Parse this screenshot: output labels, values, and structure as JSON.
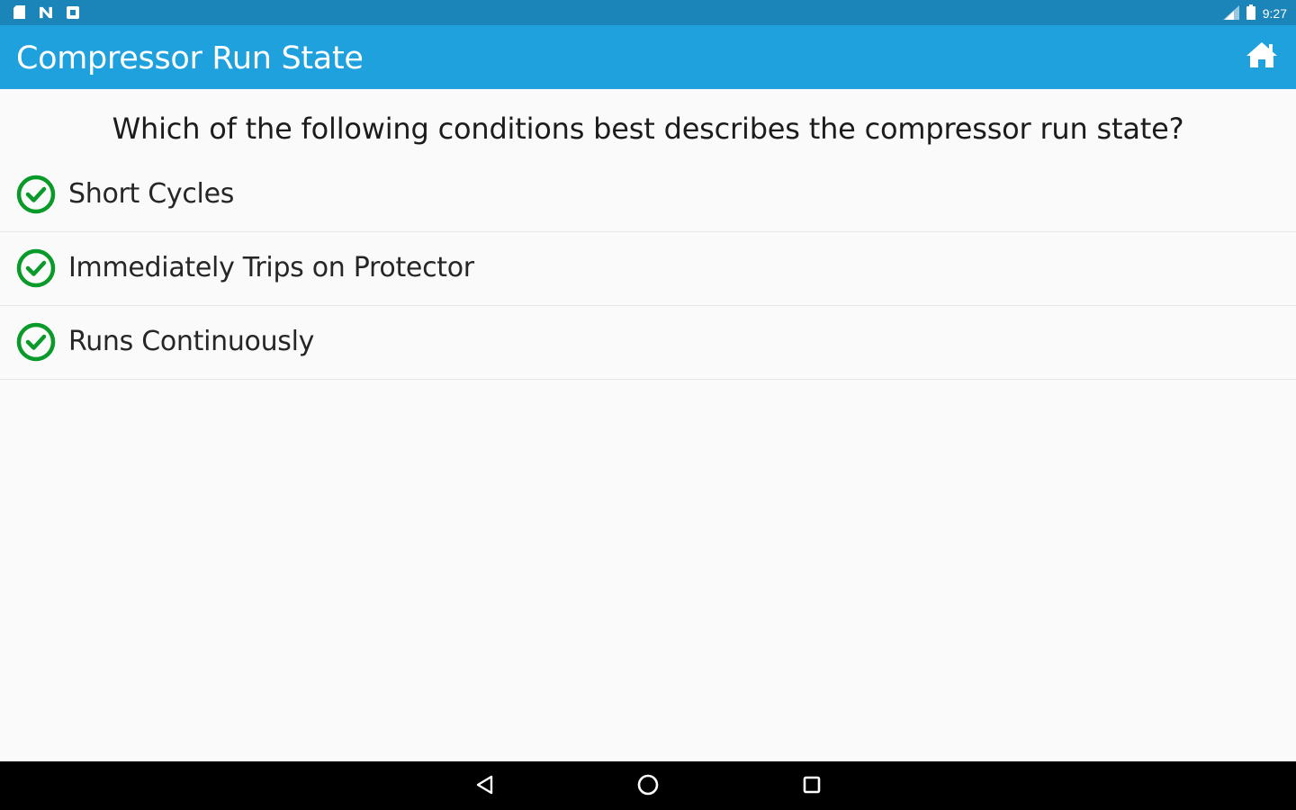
{
  "status_bar": {
    "time": "9:27",
    "left_icons": [
      "sd-card-icon",
      "n-icon",
      "notification-square-icon"
    ],
    "right_icons": [
      "signal-icon",
      "battery-icon"
    ]
  },
  "app_bar": {
    "title": "Compressor Run State",
    "home_icon": "home-icon"
  },
  "question": {
    "text": "Which of the following conditions best describes the compressor run state?"
  },
  "answers": [
    {
      "label": "Short Cycles",
      "icon": "check-circle-icon"
    },
    {
      "label": "Immediately Trips on Protector",
      "icon": "check-circle-icon"
    },
    {
      "label": "Runs Continuously",
      "icon": "check-circle-icon"
    }
  ],
  "nav_bar": {
    "buttons": [
      "back-icon",
      "home-circle-icon",
      "recents-icon"
    ]
  },
  "colors": {
    "status_bar": "#1b84b8",
    "app_bar": "#1ea1dd",
    "check_green": "#0a9a2a",
    "background": "#fafafa"
  }
}
